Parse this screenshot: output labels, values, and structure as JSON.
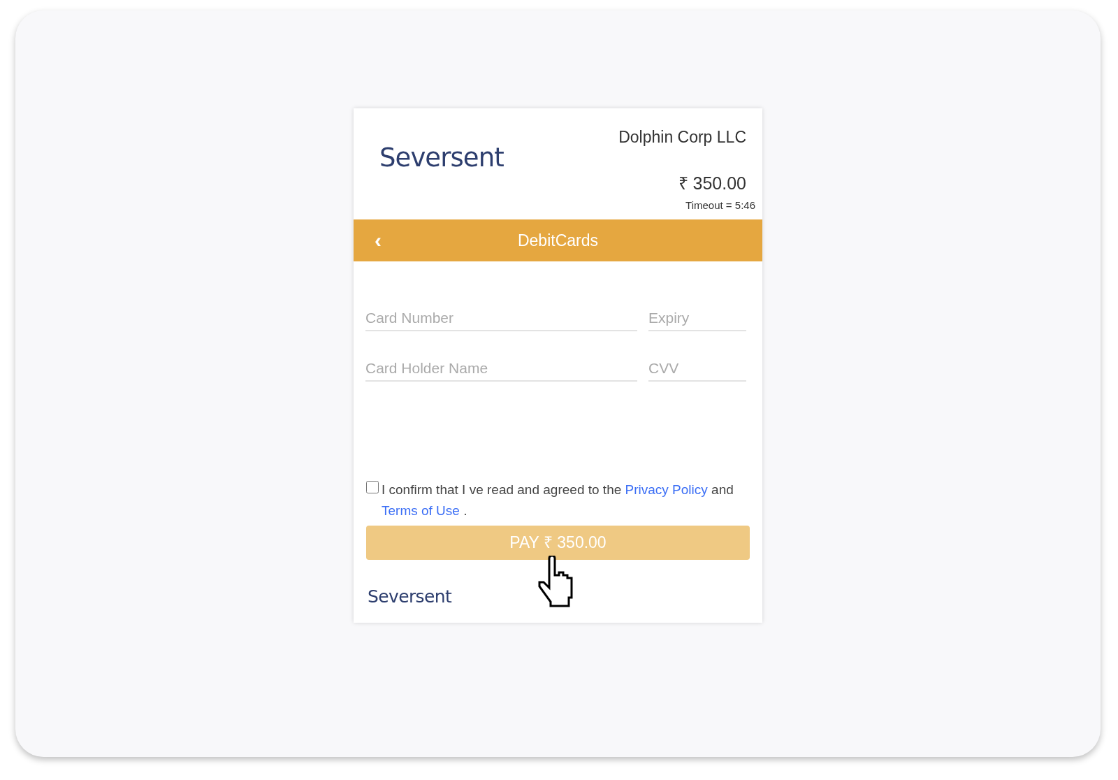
{
  "header": {
    "logo": "Seversent",
    "merchant": "Dolphin Corp LLC",
    "amount": "₹ 350.00",
    "timeout": "Timeout = 5:46"
  },
  "method_bar": {
    "back": "‹",
    "title": "DebitCards"
  },
  "fields": [
    {
      "placeholder": "Card Number"
    },
    {
      "placeholder": "Expiry"
    },
    {
      "placeholder": "Card Holder Name"
    },
    {
      "placeholder": "CVV"
    }
  ],
  "consent": {
    "checked": false,
    "parts": [
      {
        "kind": "text",
        "text": "I confirm that I ve read and agreed to the"
      },
      {
        "kind": "link",
        "text": "Privacy Policy"
      },
      {
        "kind": "text",
        "text": "and"
      },
      {
        "kind": "link",
        "text": "Terms of Use"
      },
      {
        "kind": "text",
        "text": "."
      }
    ]
  },
  "pay_button": {
    "label": "PAY ₹ 350.00",
    "disabled": true
  },
  "footer": {
    "logo": "Seversent"
  }
}
